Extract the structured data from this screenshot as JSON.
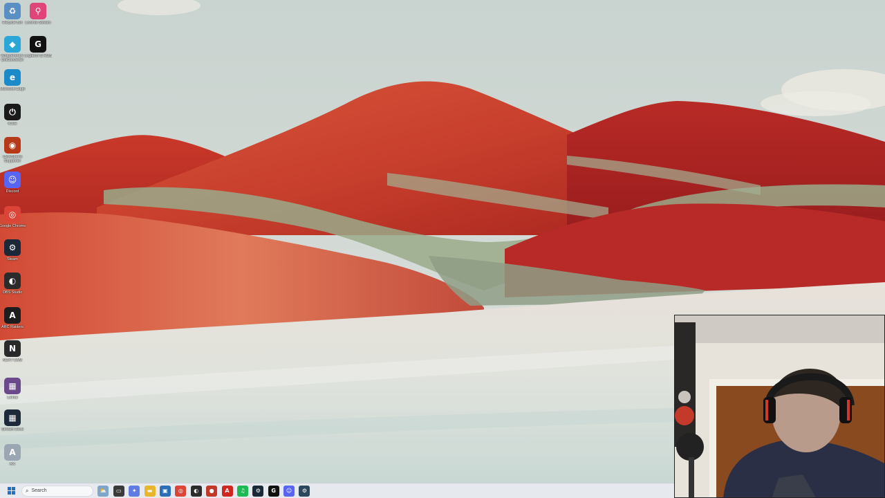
{
  "desktop": {
    "icons": [
      {
        "label": "Recycle Bin",
        "icon": "recycle-bin-icon",
        "glyph": "♻",
        "color": "#5a8fc4"
      },
      {
        "label": "Loomis Stream",
        "icon": "map-pin-icon",
        "glyph": "⚲",
        "color": "#e0457a"
      },
      {
        "label": "Wondershare UniConverter",
        "icon": "wondershare-icon",
        "glyph": "◆",
        "color": "#2aa7d6"
      },
      {
        "label": "Logitech G HUB",
        "icon": "logitech-g-icon",
        "glyph": "G",
        "color": "#111111"
      },
      {
        "label": "Microsoft Edge",
        "icon": "edge-icon",
        "glyph": "e",
        "color": "#1b8ac9"
      },
      {
        "label": "iCUE",
        "icon": "icue-icon",
        "glyph": "⏻",
        "color": "#1a1a1a"
      },
      {
        "label": "ClickSpeed Supporter",
        "icon": "clickspeed-icon",
        "glyph": "◉",
        "color": "#b43a1a"
      },
      {
        "label": "Discord",
        "icon": "discord-icon",
        "glyph": "☺",
        "color": "#5865f2"
      },
      {
        "label": "Google Chrome",
        "icon": "chrome-icon",
        "glyph": "◎",
        "color": "#db4437"
      },
      {
        "label": "Steam",
        "icon": "steam-icon",
        "glyph": "⚙",
        "color": "#1b2838"
      },
      {
        "label": "OBS Studio",
        "icon": "obs-icon",
        "glyph": "◐",
        "color": "#2b2b2b"
      },
      {
        "label": "ARC Raiders",
        "icon": "arc-raiders-icon",
        "glyph": "A",
        "color": "#1d1d1d"
      },
      {
        "label": "NZXT CAM",
        "icon": "nzxt-icon",
        "glyph": "N",
        "color": "#2a2a2a"
      },
      {
        "label": "Lethal",
        "icon": "game-icon",
        "glyph": "▦",
        "color": "#6a4a8a"
      },
      {
        "label": "Stream Deck",
        "icon": "stream-deck-icon",
        "glyph": "▦",
        "color": "#1e2a3a"
      },
      {
        "label": "Arc",
        "icon": "font-a-icon",
        "glyph": "A",
        "color": "#9aa7b2"
      }
    ]
  },
  "taskbar": {
    "start_glyph": "⊞",
    "search_placeholder": "Search",
    "apps": [
      {
        "name": "widgets-icon",
        "glyph": "⛅",
        "color": "#7fa6c8"
      },
      {
        "name": "task-view-icon",
        "glyph": "▭",
        "color": "#3a3a3a"
      },
      {
        "name": "copilot-icon",
        "glyph": "✦",
        "color": "#5e7ce2"
      },
      {
        "name": "file-explorer-icon",
        "glyph": "▬",
        "color": "#e8b62c"
      },
      {
        "name": "store-icon",
        "glyph": "▣",
        "color": "#2d6fb5"
      },
      {
        "name": "chrome-icon",
        "glyph": "◎",
        "color": "#db4437"
      },
      {
        "name": "obs-icon",
        "glyph": "◐",
        "color": "#2b2b2b"
      },
      {
        "name": "app-red-icon",
        "glyph": "●",
        "color": "#c0392b"
      },
      {
        "name": "adobe-icon",
        "glyph": "A",
        "color": "#d1261f"
      },
      {
        "name": "spotify-icon",
        "glyph": "♫",
        "color": "#1db954"
      },
      {
        "name": "steam-icon",
        "glyph": "⚙",
        "color": "#1b2838"
      },
      {
        "name": "logitech-g-icon",
        "glyph": "G",
        "color": "#111111"
      },
      {
        "name": "discord-icon",
        "glyph": "☺",
        "color": "#5865f2"
      },
      {
        "name": "steam-2-icon",
        "glyph": "⚙",
        "color": "#2a475e"
      }
    ]
  }
}
